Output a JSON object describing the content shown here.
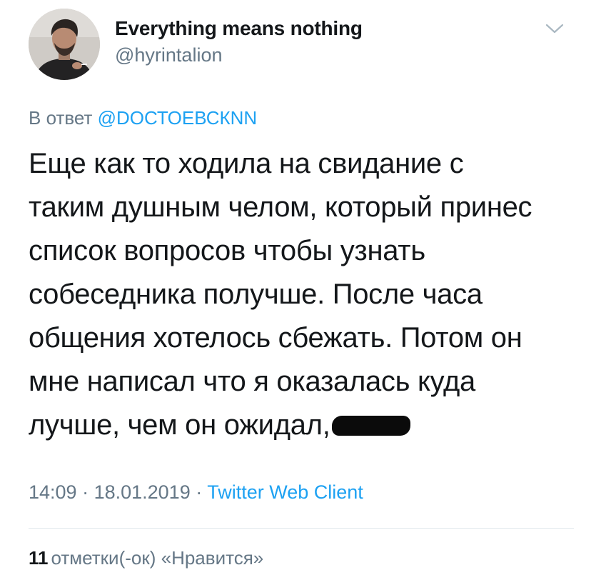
{
  "user": {
    "display_name": "Everything means nothing",
    "handle": "@hyrintalion"
  },
  "reply": {
    "prefix": "В ответ ",
    "mention": "@DОСТОЕВСКNN"
  },
  "tweet": {
    "lines": [
      "Еще как то ходила на свидание с",
      "таким душным челом, который принес",
      "список вопросов чтобы узнать",
      "собеседника получше. После часа",
      "общения хотелось сбежать. Потом он",
      "мне написал что я оказалась куда",
      "лучше, чем он ожидал,"
    ]
  },
  "meta": {
    "time": "14:09",
    "separator1": " · ",
    "date": "18.01.2019",
    "separator2": " · ",
    "client": "Twitter Web Client"
  },
  "likes": {
    "count": "11",
    "label": "отметки(-ок) «Нравится»"
  },
  "icons": {
    "menu": "chevron-down-icon"
  },
  "colors": {
    "link": "#1da1f2",
    "secondary": "#657786",
    "text": "#14171a",
    "divider": "#e1e8ed"
  }
}
